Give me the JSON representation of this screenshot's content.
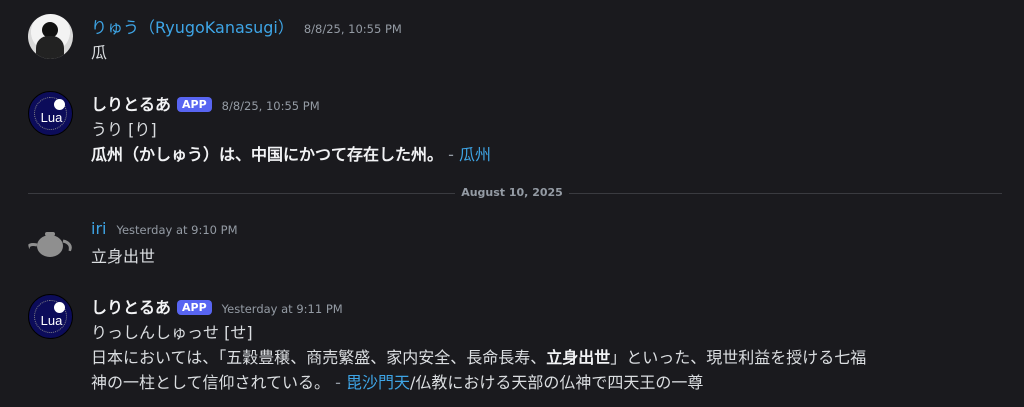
{
  "messages": [
    {
      "author": "りゅう（RyugoKanasugi）",
      "timestamp": "8/8/25, 10:55 PM",
      "content": "瓜",
      "avatar_icon": "user-photo-icon"
    },
    {
      "author": "しりとるあ",
      "badge": "APP",
      "timestamp": "8/8/25, 10:55 PM",
      "reading": "うり [り]",
      "definition_bold": "瓜州（かしゅう）は、中国にかつて存在した州。",
      "link_text": "瓜州",
      "separator": " - ",
      "avatar_icon": "lua-logo-icon",
      "avatar_text": "Lua"
    },
    {
      "author": "iri",
      "timestamp": "Yesterday at 9:10 PM",
      "content": "立身出世",
      "avatar_icon": "teapot-icon"
    },
    {
      "author": "しりとるあ",
      "badge": "APP",
      "timestamp": "Yesterday at 9:11 PM",
      "reading": "りっしんしゅっせ [せ]",
      "definition_part1": "日本においては、「五穀豊穣、商売繁盛、家内安全、長命長寿、",
      "definition_bold": "立身出世",
      "definition_part2": "」といった、現世利益を授ける七福",
      "definition_line2": "神の一柱として信仰されている。",
      "separator": " - ",
      "link_text": "毘沙門天",
      "link_suffix": "/仏教における天部の仏神で四天王の一尊",
      "avatar_icon": "lua-logo-icon",
      "avatar_text": "Lua"
    }
  ],
  "date_divider": "August 10, 2025",
  "colors": {
    "background": "#1a1a1e",
    "link": "#3ea5e6",
    "badge": "#5865f2",
    "timestamp": "#949ba4"
  }
}
